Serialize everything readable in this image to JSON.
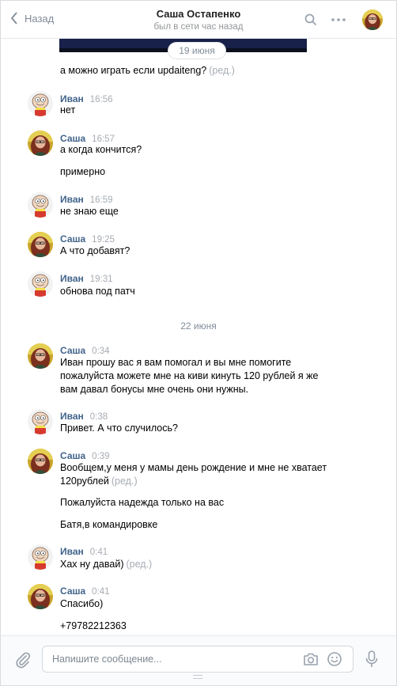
{
  "header": {
    "back_label": "Назад",
    "title": "Саша Остапенко",
    "subtitle": "был в сети час назад"
  },
  "feed": {
    "date1": "19 июня",
    "date2": "22 июня",
    "edited_label": "(ред.)",
    "msgs": {
      "m0": {
        "text": "а можно играть если updaiteng?"
      },
      "m1": {
        "name": "Иван",
        "time": "16:56",
        "text": "нет"
      },
      "m2": {
        "name": "Саша",
        "time": "16:57",
        "text": "а когда кончится?",
        "text2": "примерно"
      },
      "m3": {
        "name": "Иван",
        "time": "16:59",
        "text": "не знаю еще"
      },
      "m4": {
        "name": "Саша",
        "time": "19:25",
        "text": "А что добавят?"
      },
      "m5": {
        "name": "Иван",
        "time": "19:31",
        "text": "обнова под патч"
      },
      "m6": {
        "name": "Саша",
        "time": "0:34",
        "text": "Иван прошу вас я вам помогал и вы мне помогите пожалуйста можете мне на киви кинуть 120 рублей я же вам давал бонусы мне очень они нужны."
      },
      "m7": {
        "name": "Иван",
        "time": "0:38",
        "text": "Привет. А что случилось?"
      },
      "m8": {
        "name": "Саша",
        "time": "0:39",
        "text": "Вообщем,у меня у мамы день рождение и мне не хватает 120рублей",
        "text2": "Пожалуйста надежда только на вас",
        "text3": "Батя,в командировке"
      },
      "m9": {
        "name": "Иван",
        "time": "0:41",
        "text": "Хах ну давай)"
      },
      "m10": {
        "name": "Саша",
        "time": "0:41",
        "text": "Спасибо)",
        "text2": "+79782212363"
      }
    }
  },
  "composer": {
    "placeholder": "Напишите сообщение..."
  },
  "icons": {
    "back": "chevron-left-icon",
    "search": "search-icon",
    "more": "more-dots-icon",
    "attach": "paperclip-icon",
    "camera": "camera-icon",
    "emoji": "smile-icon",
    "mic": "microphone-icon"
  },
  "colors": {
    "name_link": "#42648b",
    "muted": "#a6acb3",
    "accent_icon": "#99a2ad"
  }
}
